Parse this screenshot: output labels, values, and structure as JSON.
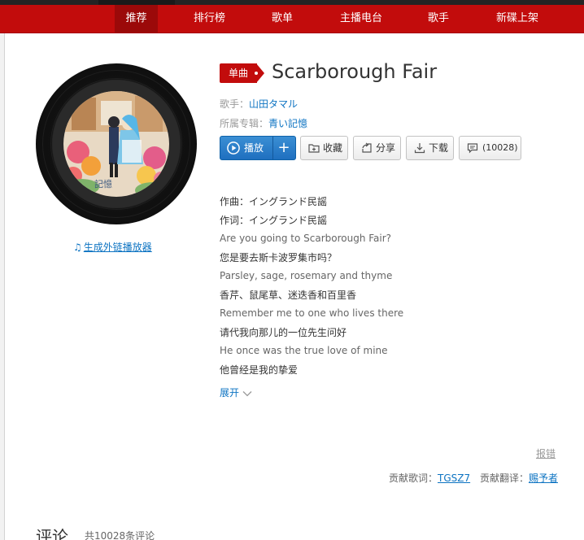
{
  "nav": {
    "items": [
      "推荐",
      "排行榜",
      "歌单",
      "主播电台",
      "歌手",
      "新碟上架"
    ],
    "active_index": 0
  },
  "song": {
    "tag": "单曲",
    "title": "Scarborough Fair",
    "artist_label": "歌手：",
    "artist": "山田タマル",
    "album_label": "所属专辑：",
    "album": "青い記憶"
  },
  "buttons": {
    "play": "播放",
    "add": "+",
    "collect": "收藏",
    "share": "分享",
    "download": "下载",
    "comment": "(10028)"
  },
  "cover": {
    "caption": "記憶"
  },
  "gen_player_link": "生成外链播放器",
  "lyrics": [
    {
      "text": "作曲：イングランド民謡",
      "lang": "zh"
    },
    {
      "text": "作词：イングランド民謡",
      "lang": "zh"
    },
    {
      "text": "Are you going to Scarborough Fair?",
      "lang": "en"
    },
    {
      "text": "您是要去斯卡波罗集市吗？",
      "lang": "zh"
    },
    {
      "text": "Parsley, sage, rosemary and thyme",
      "lang": "en"
    },
    {
      "text": "香芹、鼠尾草、迷迭香和百里香",
      "lang": "zh"
    },
    {
      "text": "Remember me to one who lives there",
      "lang": "en"
    },
    {
      "text": "请代我向那儿的一位先生问好",
      "lang": "zh"
    },
    {
      "text": "He once was the true love of mine",
      "lang": "en"
    },
    {
      "text": "他曾经是我的挚爱",
      "lang": "zh"
    }
  ],
  "expand_label": "展开",
  "report_label": "报错",
  "contrib": {
    "lyric_label": "贡献歌词：",
    "lyric_user": "TGSZ7",
    "trans_label": "贡献翻译：",
    "trans_user": "赐予者"
  },
  "comments": {
    "title": "评论",
    "count": "共10028条评论"
  },
  "colors": {
    "brand_red": "#c20c0c",
    "link_blue": "#0c73c2",
    "play_blue": "#2b7fc8"
  }
}
